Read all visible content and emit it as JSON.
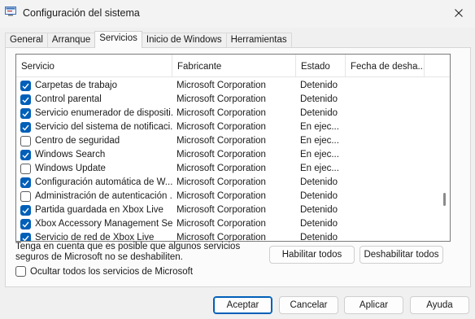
{
  "window": {
    "title": "Configuración del sistema",
    "icon": "system-config-icon"
  },
  "tabs": [
    {
      "label": "General",
      "active": false
    },
    {
      "label": "Arranque",
      "active": false
    },
    {
      "label": "Servicios",
      "active": true
    },
    {
      "label": "Inicio de Windows",
      "active": false
    },
    {
      "label": "Herramientas",
      "active": false
    }
  ],
  "services": {
    "columns": [
      "Servicio",
      "Fabricante",
      "Estado",
      "Fecha de desha..."
    ],
    "rows": [
      {
        "name": "Carpetas de trabajo",
        "manufacturer": "Microsoft Corporation",
        "status": "Detenido",
        "checked": true
      },
      {
        "name": "Control parental",
        "manufacturer": "Microsoft Corporation",
        "status": "Detenido",
        "checked": true
      },
      {
        "name": "Servicio enumerador de dispositi...",
        "manufacturer": "Microsoft Corporation",
        "status": "Detenido",
        "checked": true
      },
      {
        "name": "Servicio del sistema de notificaci...",
        "manufacturer": "Microsoft Corporation",
        "status": "En ejec...",
        "checked": true
      },
      {
        "name": "Centro de seguridad",
        "manufacturer": "Microsoft Corporation",
        "status": "En ejec...",
        "checked": false
      },
      {
        "name": "Windows Search",
        "manufacturer": "Microsoft Corporation",
        "status": "En ejec...",
        "checked": true
      },
      {
        "name": "Windows Update",
        "manufacturer": "Microsoft Corporation",
        "status": "En ejec...",
        "checked": false
      },
      {
        "name": "Configuración automática de W...",
        "manufacturer": "Microsoft Corporation",
        "status": "Detenido",
        "checked": true
      },
      {
        "name": "Administración de autenticación ...",
        "manufacturer": "Microsoft Corporation",
        "status": "Detenido",
        "checked": false
      },
      {
        "name": "Partida guardada en Xbox Live",
        "manufacturer": "Microsoft Corporation",
        "status": "Detenido",
        "checked": true
      },
      {
        "name": "Xbox Accessory Management Se...",
        "manufacturer": "Microsoft Corporation",
        "status": "Detenido",
        "checked": true
      },
      {
        "name": "Servicio de red de Xbox Live",
        "manufacturer": "Microsoft Corporation",
        "status": "Detenido",
        "checked": true
      }
    ],
    "scroll_position": 0.78
  },
  "note": "Tenga en cuenta que es posible que algunos servicios seguros de Microsoft no se deshabiliten.",
  "buttons": {
    "enable_all": "Habilitar todos",
    "disable_all": "Deshabilitar todos",
    "accept": "Aceptar",
    "cancel": "Cancelar",
    "apply": "Aplicar",
    "help": "Ayuda"
  },
  "hide_microsoft": {
    "label": "Ocultar todos los servicios de Microsoft",
    "checked": false
  },
  "colors": {
    "accent": "#005fb8",
    "background": "#f0f0f0"
  }
}
